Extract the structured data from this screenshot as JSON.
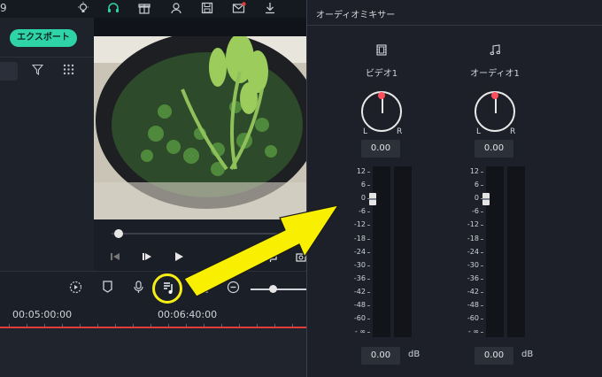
{
  "topbar": {
    "left_number": "9",
    "icons": [
      "lightbulb-icon",
      "headset-icon",
      "gift-icon",
      "user-icon",
      "save-icon",
      "mail-icon",
      "download-icon"
    ]
  },
  "left_panel": {
    "export_label": "エクスポート"
  },
  "preview": {
    "seek_progress": 0.03
  },
  "timeline": {
    "ruler_labels": [
      "00:05:00:00",
      "00:06:40:00"
    ]
  },
  "mixer": {
    "title": "オーディオミキサー",
    "channels": [
      {
        "icon": "film-icon",
        "label": "ビデオ1",
        "knob_value": "0.00",
        "knob_left": "L",
        "knob_right": "R",
        "fader_value": "0.00",
        "fader_level_db": 0
      },
      {
        "icon": "music-note-icon",
        "label": "オーディオ1",
        "knob_value": "0.00",
        "knob_left": "L",
        "knob_right": "R",
        "fader_value": "0.00",
        "fader_level_db": 0
      }
    ],
    "scale": [
      "12",
      "6",
      "0",
      "-6",
      "-12",
      "-18",
      "-24",
      "-30",
      "-36",
      "-42",
      "-48",
      "-60",
      "- ∞"
    ],
    "unit": "dB"
  },
  "colors": {
    "accent": "#2fd3a8",
    "highlight": "#f7ee16",
    "playhead": "#e23b3b",
    "knob_dot": "#ff4d5b"
  }
}
